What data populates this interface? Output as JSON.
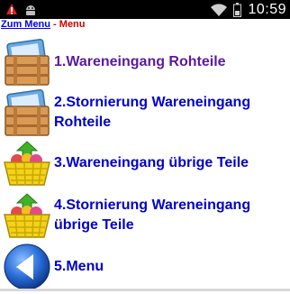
{
  "status_bar": {
    "clock": "10:59",
    "icons": [
      "alert-icon",
      "android-icon",
      "wifi-icon",
      "battery-icon"
    ]
  },
  "breadcrumb": {
    "link": "Zum Menu",
    "separator": " - ",
    "current": "Menu"
  },
  "menu": {
    "items": [
      {
        "label": "1.Wareneingang Rohteile",
        "icon": "wooden-crate-icon",
        "color": "#5b1a9e"
      },
      {
        "label": "2.Stornierung Wareneingang Rohteile",
        "icon": "wooden-crate-icon",
        "color": "#0000cc"
      },
      {
        "label": "3.Wareneingang übrige Teile",
        "icon": "shopping-basket-icon",
        "color": "#0000cc"
      },
      {
        "label": "4.Stornierung Wareneingang übrige Teile",
        "icon": "shopping-basket-icon",
        "color": "#0000cc"
      },
      {
        "label": "5.Menu",
        "icon": "back-arrow-icon",
        "color": "#0000cc"
      }
    ]
  }
}
